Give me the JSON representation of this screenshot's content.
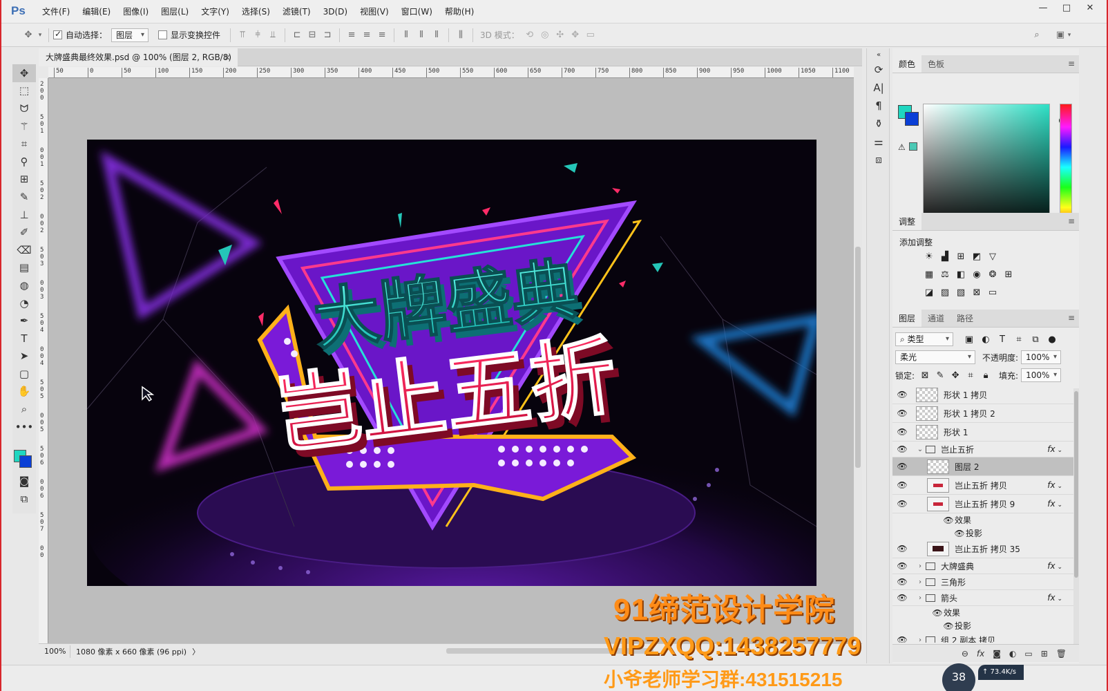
{
  "menubar": {
    "app_logo": "Ps",
    "items": [
      "文件(F)",
      "编辑(E)",
      "图像(I)",
      "图层(L)",
      "文字(Y)",
      "选择(S)",
      "滤镜(T)",
      "3D(D)",
      "视图(V)",
      "窗口(W)",
      "帮助(H)"
    ],
    "window_controls": [
      "—",
      "□",
      "✕"
    ]
  },
  "options": {
    "auto_select_label": "自动选择：",
    "auto_select_checked": true,
    "target_value": "图层",
    "transform_label": "显示变换控件",
    "mode_3d_label": "3D 模式："
  },
  "document": {
    "tab_title": "大牌盛典最终效果.psd @ 100% (图层 2, RGB/8)",
    "close_glyph": "×",
    "ruler_top": [
      "50",
      "0",
      "50",
      "100",
      "150",
      "200",
      "250",
      "300",
      "350",
      "400",
      "450",
      "500",
      "550",
      "600",
      "650",
      "700",
      "750",
      "800",
      "850",
      "900",
      "950",
      "1000",
      "1050",
      "1100"
    ],
    "ruler_left": [
      "2",
      "0",
      "0",
      "5",
      "0",
      "1",
      "0",
      "0",
      "1",
      "5",
      "0",
      "2",
      "0",
      "0",
      "2",
      "5",
      "0",
      "3",
      "0",
      "0",
      "3",
      "5",
      "0",
      "4",
      "0",
      "0",
      "4",
      "5",
      "0",
      "5",
      "0",
      "0",
      "5",
      "5",
      "0",
      "6",
      "0",
      "0",
      "6",
      "5",
      "0",
      "7",
      "0",
      "0"
    ],
    "artwork": {
      "line1": "大牌盛典",
      "line2": "岂止五折"
    }
  },
  "status": {
    "zoom": "100%",
    "doc_info": "1080 像素 x 660 像素 (96 ppi)",
    "arrow": "〉"
  },
  "color_panel": {
    "tabs": [
      "颜色",
      "色板"
    ],
    "foreground": "#1fd6c0",
    "background": "#0a3fd6"
  },
  "adjust_panel": {
    "tab": "调整",
    "add_label": "添加调整"
  },
  "layers_panel": {
    "tabs": [
      "图层",
      "通道",
      "路径"
    ],
    "filter_label": "类型",
    "blend_mode": "柔光",
    "opacity_label": "不透明度:",
    "opacity_value": "100%",
    "lock_label": "锁定:",
    "fill_label": "填充:",
    "fill_value": "100%",
    "rows": [
      {
        "name": "形状 1 拷贝",
        "kind": "shape",
        "indent": 0,
        "fx": false,
        "selected": false
      },
      {
        "name": "形状 1 拷贝 2",
        "kind": "shape",
        "indent": 0,
        "fx": false,
        "selected": false
      },
      {
        "name": "形状 1",
        "kind": "shape",
        "indent": 0,
        "fx": false,
        "selected": false
      },
      {
        "name": "岂止五折",
        "kind": "group-open",
        "indent": 0,
        "fx": true,
        "selected": false
      },
      {
        "name": "图层 2",
        "kind": "pixel",
        "indent": 1,
        "fx": false,
        "selected": true
      },
      {
        "name": "岂止五折 拷贝",
        "kind": "text",
        "indent": 1,
        "fx": true,
        "selected": false
      },
      {
        "name": "岂止五折 拷贝 9",
        "kind": "text",
        "indent": 1,
        "fx": true,
        "selected": false
      },
      {
        "name": "效果",
        "kind": "effect",
        "indent": 2,
        "fx": false,
        "selected": false
      },
      {
        "name": "投影",
        "kind": "effect-item",
        "indent": 3,
        "fx": false,
        "selected": false
      },
      {
        "name": "岂止五折 拷贝 35",
        "kind": "dark",
        "indent": 1,
        "fx": false,
        "selected": false
      },
      {
        "name": "大牌盛典",
        "kind": "group",
        "indent": 0,
        "fx": true,
        "selected": false
      },
      {
        "name": "三角形",
        "kind": "group",
        "indent": 0,
        "fx": false,
        "selected": false
      },
      {
        "name": "箭头",
        "kind": "group",
        "indent": 0,
        "fx": true,
        "selected": false
      },
      {
        "name": "效果",
        "kind": "effect",
        "indent": 1,
        "fx": false,
        "selected": false
      },
      {
        "name": "投影",
        "kind": "effect-item",
        "indent": 2,
        "fx": false,
        "selected": false
      },
      {
        "name": "组 2 副本 拷贝",
        "kind": "group",
        "indent": 0,
        "fx": false,
        "selected": false
      }
    ]
  },
  "watermark": {
    "line1": "91缔范设计学院",
    "line2": "VIPZXQQ:1438257779",
    "line3": "小爷老师学习群:431515215"
  },
  "taskbar": {
    "bubble": "38",
    "net_speed": "↑ 73.4K/s"
  }
}
